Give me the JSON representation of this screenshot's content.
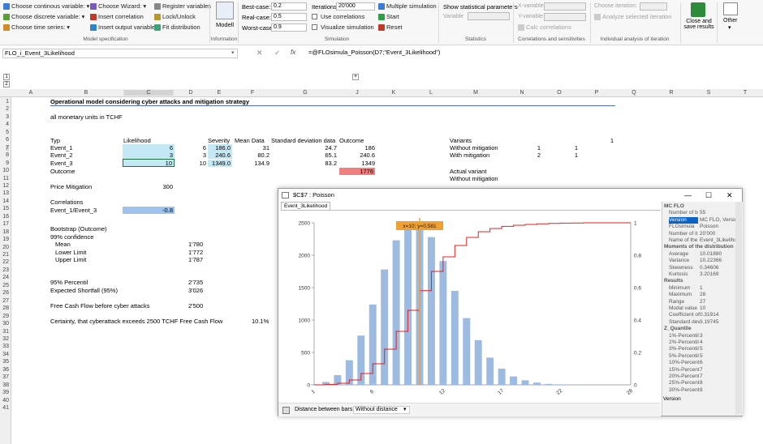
{
  "ribbon": {
    "col1": [
      "Choose continous variable:",
      "Choose discrete variable:",
      "Choose time series:"
    ],
    "col2": [
      "Choose Wizard:",
      "Insert correlation",
      "Insert output variable"
    ],
    "col3": [
      "Register variables",
      "Lock/Unlock",
      "Fit distribution"
    ],
    "modell_label": "Modell",
    "cases": [
      {
        "label": "Best-case:",
        "value": "0.2"
      },
      {
        "label": "Real-case:",
        "value": "0.5"
      },
      {
        "label": "Worst-case:",
        "value": "0.9"
      }
    ],
    "iterations_label": "Iterations:",
    "iterations_value": "20'000",
    "use_corr": "Use correlations",
    "visualize": "Visualize simulation",
    "multiple_sim": "Multiple simulation",
    "start": "Start",
    "reset": "Reset",
    "show_stats": "Show statistical parameters",
    "variable_label": "Variable",
    "x_var": "X-variable",
    "y_var": "Y-variable",
    "calc_corr": "Calc correlations",
    "choose_iter": "Choose iteration:",
    "analyze_iter": "Analyze selected iteration",
    "close_save": [
      "Close and",
      "save results"
    ],
    "other": "Other",
    "groups": [
      "Model specification",
      "Information",
      "Simulation",
      "Statistics",
      "Correlations and sensitivities",
      "Individual analysis of iteration"
    ]
  },
  "formula_bar": {
    "name_box": "FLO_i_Event_3Likelihood",
    "formula": "=@FLOsimula_Poisson(D7;\"Event_3Likelihood\")",
    "fx": "fx"
  },
  "columns": [
    "A",
    "B",
    "C",
    "D",
    "E",
    "F",
    "G",
    "J",
    "K",
    "L",
    "M",
    "N",
    "O",
    "P",
    "Q",
    "R",
    "S",
    "T"
  ],
  "rows": [
    "1",
    "2",
    "3",
    "4",
    "5",
    "6",
    "7",
    "8",
    "9",
    "10",
    "11",
    "12",
    "13",
    "14",
    "15",
    "16",
    "17",
    "18",
    "19",
    "20",
    "21",
    "22",
    "23",
    "24",
    "25",
    "26",
    "27",
    "28",
    "29",
    "30",
    "31",
    "32",
    "33",
    "34",
    "35",
    "36",
    "37",
    "38",
    "39",
    "40",
    "41"
  ],
  "sheet": {
    "title": "Operational model considering cyber attacks and mitigation strategy",
    "units": "all monetary units in TCHF",
    "hdr": {
      "typ": "Typ",
      "likelihood": "Likelihood",
      "severity": "Severity",
      "mean": "Mean Data",
      "sd": "Standard deviation data",
      "outcome": "Outcome"
    },
    "events": [
      {
        "name": "Event_1",
        "lik": "6",
        "d": "6",
        "sev": "186.0",
        "mean": "31",
        "sd": "24.7",
        "out": "186"
      },
      {
        "name": "Event_2",
        "lik": "3",
        "d": "3",
        "sev": "240.6",
        "mean": "80.2",
        "sd": "65.1",
        "out": "240.6"
      },
      {
        "name": "Event_3",
        "lik": "10",
        "d": "10",
        "sev": "1349.0",
        "mean": "134.9",
        "sd": "83.2",
        "out": "1349"
      }
    ],
    "outcome_label": "Outcome",
    "outcome_value": "1776",
    "price_label": "Price Mitigation",
    "price_value": "300",
    "corr_label": "Correlations",
    "corr_name": "Event_1/Event_3",
    "corr_value": "-0.8",
    "boot": "Bootstrap (Outcome)",
    "conf": "99% confidence",
    "mean_l": "Mean",
    "mean_v": "1'780",
    "lower_l": "Lower Limit",
    "lower_v": "1'772",
    "upper_l": "Upper Limit",
    "upper_v": "1'787",
    "p95_l": "95% Percentil",
    "p95_v": "2'735",
    "es_l": "Expected Shortfall (95%)",
    "es_v": "3'026",
    "fcf_l": "Free Cash Flow before cyber attacks",
    "fcf_v": "2'500",
    "cert_l": "Certainty, that cyberattack exceeds 2500 TCHF Free Cash Flow",
    "cert_v": "10.1%",
    "variants": "Variants",
    "variants_v": "1",
    "without": "Without mitigation",
    "with": "With mitigation",
    "without_n": "1",
    "without_o": "1",
    "with_n": "2",
    "with_o": "1",
    "actual": "Actual variant",
    "actual_v": "Without mitigation"
  },
  "popup": {
    "title": "$C$7 : Poisson",
    "tab": "Event_3Likelihood",
    "tooltip": "x=10; y=0.581",
    "bottom_label": "Distance between bars:",
    "bottom_value": "Without distance",
    "side_bottom": "Version",
    "side": [
      {
        "h": "MC FLO"
      },
      {
        "k": "Number of b",
        "v": "55"
      },
      {
        "k": "Version",
        "v": "MC FLO, Version",
        "sel": true
      },
      {
        "k": "FLOsimula",
        "v": "Poisson"
      },
      {
        "k": "Number of it",
        "v": "20'000"
      },
      {
        "k": "Name of the",
        "v": "Event_3Likelihood"
      },
      {
        "h": "Moments of the distribution"
      },
      {
        "k": "Average",
        "v": "10.01880"
      },
      {
        "k": "Variance",
        "v": "10.22366"
      },
      {
        "k": "Skewness",
        "v": "0.34606"
      },
      {
        "k": "Kurtosis",
        "v": "3.20169"
      },
      {
        "h": "Results"
      },
      {
        "k": "Minimum",
        "v": "1"
      },
      {
        "k": "Maximum",
        "v": "28"
      },
      {
        "k": "Range",
        "v": "27"
      },
      {
        "k": "Modal value",
        "v": "10"
      },
      {
        "k": "Coefficient of",
        "v": "0.31914"
      },
      {
        "k": "Standard dev",
        "v": "3.19745"
      },
      {
        "h": "Z_Quantile"
      },
      {
        "k": "1%-Percentil",
        "v": "3"
      },
      {
        "k": "2%-Percentil",
        "v": "4"
      },
      {
        "k": "3%-Percentil",
        "v": "5"
      },
      {
        "k": "5%-Percentil",
        "v": "5"
      },
      {
        "k": "10%-Percent",
        "v": "6"
      },
      {
        "k": "15%-Percent",
        "v": "7"
      },
      {
        "k": "20%-Percent",
        "v": "7"
      },
      {
        "k": "25%-Percent",
        "v": "8"
      },
      {
        "k": "30%-Percent",
        "v": "8"
      }
    ]
  },
  "chart_data": {
    "type": "bar",
    "x": [
      1,
      2,
      3,
      4,
      5,
      6,
      7,
      8,
      9,
      10,
      11,
      12,
      13,
      14,
      15,
      16,
      17,
      18,
      19,
      20,
      21,
      22,
      23,
      24,
      25,
      26,
      27,
      28
    ],
    "values": [
      8,
      45,
      150,
      380,
      760,
      1240,
      1780,
      2230,
      2480,
      2500,
      2280,
      1910,
      1450,
      1030,
      690,
      420,
      250,
      130,
      70,
      35,
      15,
      8,
      3,
      2,
      1,
      1,
      0,
      1
    ],
    "cumulative": [
      0,
      0.003,
      0.01,
      0.03,
      0.07,
      0.13,
      0.22,
      0.33,
      0.46,
      0.581,
      0.7,
      0.79,
      0.86,
      0.91,
      0.945,
      0.965,
      0.978,
      0.985,
      0.99,
      0.994,
      0.996,
      0.998,
      0.999,
      1,
      1,
      1,
      1,
      1
    ],
    "yticks": [
      0,
      500,
      1000,
      1500,
      2000,
      2500
    ],
    "y2ticks": [
      "0",
      "0.2",
      "0.4",
      "0.6",
      "0.8",
      "1"
    ],
    "xticks": [
      "1",
      "6",
      "12",
      "17",
      "22",
      "28"
    ],
    "ylim": [
      0,
      2500
    ],
    "y2lim": [
      0,
      1
    ],
    "bar_color": "#9dbbe0",
    "line_color": "#e02020",
    "marker_color": "#f0a030"
  }
}
